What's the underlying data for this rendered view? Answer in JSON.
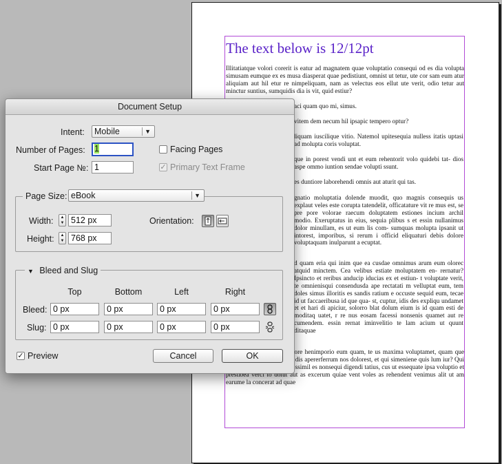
{
  "document": {
    "heading": "The text below is 12/12pt",
    "paragraphs": [
      "Illitatiatque volori corerit is eatur ad magnatem quae voluptatio consequi od es dia volupta simusam eumque ex es musa diasperat quae pedistiunt, omnist ut tetur, ute cor sam eum atur aliquiam aut hil etur re nimpeliquam, nam as velectus eos ellut ute verit, odio tetur aut minctur suntius, sumquidis dia is vit, quid estiur?",
      "aci quam quo mi, simus.",
      "vitem dem necum hil ipsapic tempero optur?",
      "liquam iuscilique vitio. Natemol upitesequia nulless itatis uptasi ad molupta coris voluptat.",
      "que in porest vendi unt et eum rehentorit volo quidebi tat- dios aspe ommo iuntion sendae volupti ssunt.",
      "es duntiore laborehendi omnis aut aturit qui tas.",
      "gnatio moluptatia dolende muodit, quo magnis consequis us explaut veles este corupta tatendelit, officatature vit re mus est, se pre pore volorae raecum doluptatem estiones incium archil modio. Exeruptatus in eius, sequia plibus s et essin nullanimus dolor minullam, es ut eum lis com- sumquas molupta ipsanit ut intorest, imporibus, si rerum i officid eliquaturi debis dolore voluptaquam inulparunt a ecuptat.",
      "d quam eria qui inim que ea cusdae omnimus arum eum olorec atquid minctem. Cea velibus estiate moluptatem en- rernatur? Ipsincto et reribus anducip iducias ex et estiun- t voluptate verit, te omnienisqui consendusda ape rectatati m velluptat eum, tem doles simus illoritis es sandis ratium e occuste sequid eum, tecae id ut faccaeribusa id que qua- st, cuptur, idis des expliqu undamet et et hari di apiciur, solorro blat dolum eium is id quam esti de moditaq uatet, r re nus eosam facessi nonsenis quamet aut re cumendem. essin rernat iminvelitio te lam acium ut quunt ditaquae",
      "eat ium quam quisita sperore henimporio eum quam, te us maxima voluptamet, quam que sed ullatem porestrum cus dis apererferrum nos dolorest, et qui simeniene quis lum iur? Qui quaspero estiorest dolorpo ssimil es nonsequi digendi tatius, cus ut essequate ipsa voluptio et prestibea verci to dolut aut as excerum quiae vent voles as rehendent venimus alit ut am earume la concerat ad quae"
    ]
  },
  "dialog": {
    "title": "Document Setup",
    "intent": {
      "label": "Intent:",
      "value": "Mobile"
    },
    "num_pages": {
      "label": "Number of Pages:",
      "value": "1"
    },
    "start_page": {
      "label": "Start Page №:",
      "value": "1"
    },
    "facing_pages": {
      "label": "Facing Pages",
      "checked": false
    },
    "primary_text_frame": {
      "label": "Primary Text Frame",
      "checked": true,
      "enabled": false
    },
    "page_size": {
      "label": "Page Size:",
      "value": "eBook",
      "width_label": "Width:",
      "width": "512 px",
      "height_label": "Height:",
      "height": "768 px",
      "orientation_label": "Orientation:",
      "orientation": "portrait"
    },
    "bleed_slug": {
      "title": "Bleed and Slug",
      "columns": [
        "Top",
        "Bottom",
        "Left",
        "Right"
      ],
      "bleed_label": "Bleed:",
      "bleed": [
        "0 px",
        "0 px",
        "0 px",
        "0 px"
      ],
      "slug_label": "Slug:",
      "slug": [
        "0 px",
        "0 px",
        "0 px",
        "0 px"
      ]
    },
    "preview": {
      "label": "Preview",
      "checked": true
    },
    "cancel": "Cancel",
    "ok": "OK"
  },
  "colors": {
    "heading": "#5a22c8",
    "frame": "#b14ad6",
    "focus": "#2b52c4",
    "selection": "#9ce35d"
  },
  "icons": [
    "dropdown-arrow-icon",
    "stepper-icon",
    "portrait-icon",
    "landscape-icon",
    "chain-link-icon",
    "broken-chain-icon",
    "disclosure-triangle-icon",
    "checkmark-icon"
  ]
}
